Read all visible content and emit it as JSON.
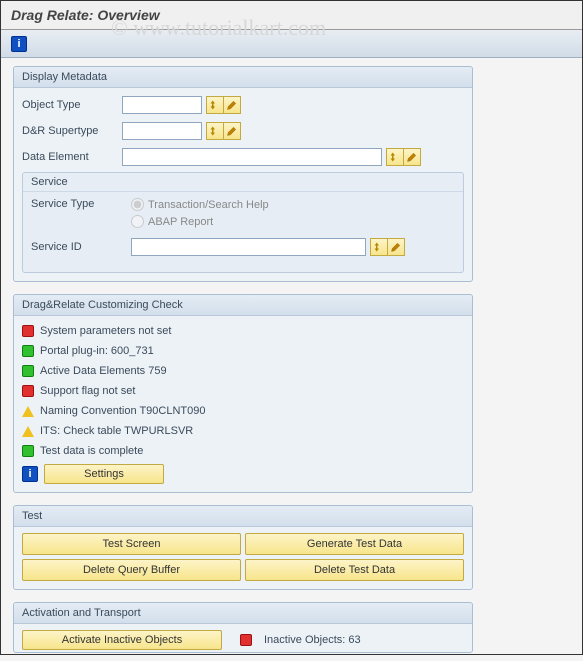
{
  "title": "Drag Relate: Overview",
  "watermark": "© www.tutorialkart.com",
  "metadata": {
    "group_title": "Display Metadata",
    "object_type_label": "Object Type",
    "object_type_value": "",
    "dr_supertype_label": "D&R Supertype",
    "dr_supertype_value": "",
    "data_element_label": "Data Element",
    "data_element_value": "",
    "service": {
      "title": "Service",
      "type_label": "Service Type",
      "radio1": "Transaction/Search Help",
      "radio2": "ABAP Report",
      "id_label": "Service ID",
      "id_value": ""
    }
  },
  "check": {
    "group_title": "Drag&Relate Customizing Check",
    "items": [
      {
        "status": "red",
        "text": "System parameters not set"
      },
      {
        "status": "green",
        "text": "Portal plug-in: 600_731"
      },
      {
        "status": "green",
        "text": "Active Data Elements 759"
      },
      {
        "status": "red",
        "text": "Support flag not set"
      },
      {
        "status": "yellow",
        "text": "Naming Convention T90CLNT090"
      },
      {
        "status": "yellow",
        "text": "ITS: Check table TWPURLSVR"
      },
      {
        "status": "green",
        "text": "Test data is complete"
      }
    ],
    "settings_btn": "Settings"
  },
  "test": {
    "group_title": "Test",
    "btn1": "Test Screen",
    "btn2": "Generate Test Data",
    "btn3": "Delete Query Buffer",
    "btn4": "Delete Test Data"
  },
  "activation": {
    "group_title": "Activation and Transport",
    "btn": "Activate Inactive Objects",
    "status_text": "Inactive Objects: 63"
  },
  "icons": {
    "display": "display-icon",
    "edit": "edit-icon",
    "info": "i"
  }
}
